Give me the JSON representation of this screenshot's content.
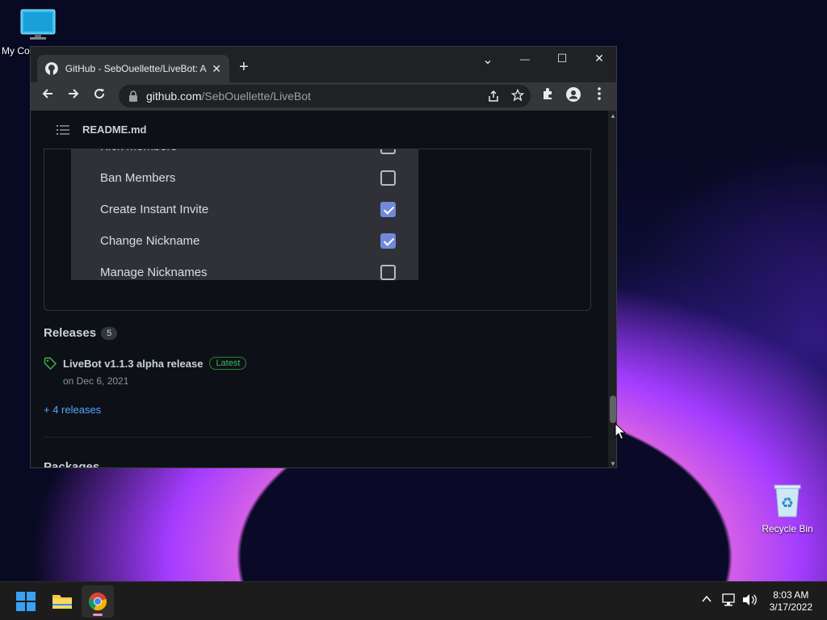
{
  "desktop": {
    "icons": [
      {
        "label": "My Co"
      },
      {
        "label": "Recycle Bin"
      }
    ]
  },
  "browser": {
    "tab_title": "GitHub - SebOuellette/LiveBot: A",
    "tab_close": "✕",
    "new_tab": "+",
    "controls": {
      "tab_search": "⌄",
      "minimize": "—",
      "maximize": "☐",
      "close": "✕"
    },
    "url_host": "github.com",
    "url_path": "/SebOuellette/LiveBot"
  },
  "readme": {
    "title": "README.md",
    "permissions": [
      {
        "label": "Kick Members",
        "checked": false
      },
      {
        "label": "Ban Members",
        "checked": false
      },
      {
        "label": "Create Instant Invite",
        "checked": true
      },
      {
        "label": "Change Nickname",
        "checked": true
      },
      {
        "label": "Manage Nicknames",
        "checked": false
      }
    ]
  },
  "releases": {
    "title": "Releases",
    "count": "5",
    "latest_name": "LiveBot v1.1.3 alpha release",
    "latest_badge": "Latest",
    "latest_date": "on Dec 6, 2021",
    "more_link": "+ 4 releases"
  },
  "packages": {
    "title": "Packages"
  },
  "taskbar": {
    "time": "8:03 AM",
    "date": "3/17/2022"
  },
  "colors": {
    "accent_check": "#7289da",
    "link": "#58a6ff",
    "latest_green": "#3fb950"
  }
}
